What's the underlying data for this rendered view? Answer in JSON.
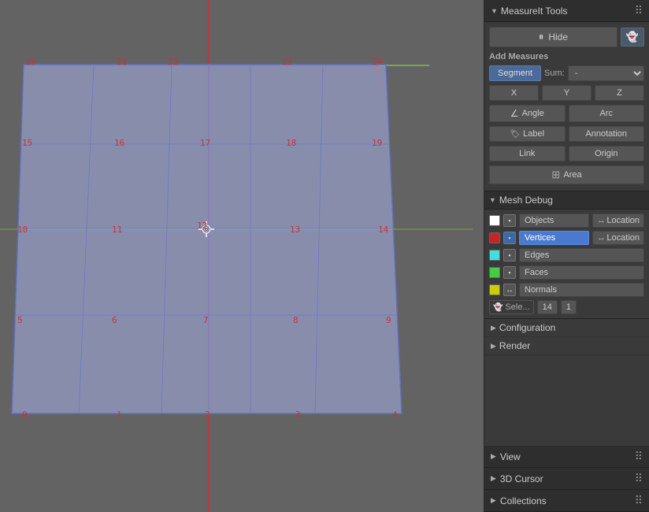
{
  "panel": {
    "title": "MeasureIt Tools",
    "hide_btn": "Hide",
    "add_measures": "Add Measures",
    "segment_btn": "Segment",
    "sum_label": "Sum:",
    "sum_value": "-",
    "x_btn": "X",
    "y_btn": "Y",
    "z_btn": "Z",
    "angle_btn": "Angle",
    "arc_btn": "Arc",
    "label_btn": "Label",
    "annotation_btn": "Annotation",
    "link_btn": "Link",
    "origin_btn": "Origin",
    "area_btn": "Area",
    "mesh_debug": "Mesh Debug",
    "objects_label": "Objects",
    "objects_location": "Location",
    "vertices_label": "Vertices",
    "vertices_location": "Location",
    "edges_label": "Edges",
    "faces_label": "Faces",
    "normals_label": "Normals",
    "sele_label": "Sele...",
    "sele_num1": "14",
    "sele_num2": "1",
    "configuration_label": "Configuration",
    "render_label": "Render",
    "view_label": "View",
    "cursor_3d_label": "3D Cursor",
    "collections_label": "Collections",
    "grid_numbers": [
      "0",
      "1",
      "2",
      "3",
      "4",
      "5",
      "6",
      "7",
      "8",
      "9",
      "10",
      "11",
      "12",
      "13",
      "14",
      "15",
      "16",
      "17",
      "18",
      "19",
      "20",
      "21",
      "22",
      "23",
      "24"
    ]
  },
  "swatches": {
    "objects": "#ffffff",
    "vertices": "#cc2222",
    "edges": "#44dddd",
    "faces": "#44cc44",
    "normals": "#cccc00"
  }
}
